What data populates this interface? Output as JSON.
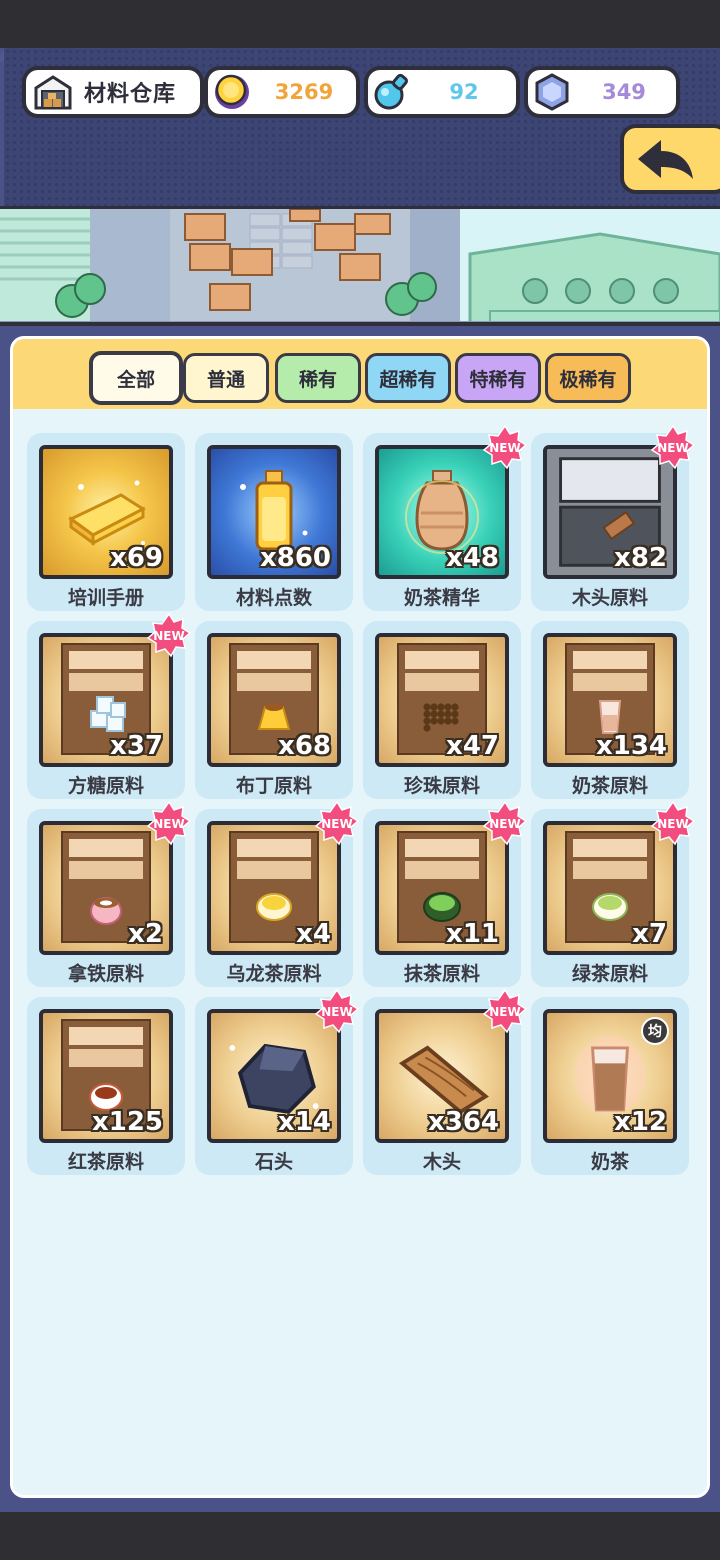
{
  "header": {
    "title": "材料仓库",
    "currencies": [
      {
        "name": "gold-coin",
        "value": "3269",
        "color": "#f0a53a"
      },
      {
        "name": "potion",
        "value": "92",
        "color": "#5fc8ea"
      },
      {
        "name": "gem",
        "value": "349",
        "color": "#a58ad8"
      }
    ]
  },
  "tabs": [
    {
      "label": "全部",
      "color": "#fffbe8",
      "active": true
    },
    {
      "label": "普通",
      "color": "#fff6cf"
    },
    {
      "label": "稀有",
      "color": "#b6ecab"
    },
    {
      "label": "超稀有",
      "color": "#8fd7f5"
    },
    {
      "label": "特稀有",
      "color": "#c9a6f5"
    },
    {
      "label": "极稀有",
      "color": "#f7bc57"
    }
  ],
  "items": [
    {
      "name": "培训手册",
      "count": "x69",
      "icon": "book-icon",
      "bg": "gold",
      "is_new": false
    },
    {
      "name": "材料点数",
      "count": "x860",
      "icon": "bottle-icon",
      "bg": "blue",
      "is_new": false
    },
    {
      "name": "奶茶精华",
      "count": "x48",
      "icon": "jar-icon",
      "bg": "teal",
      "is_new": true
    },
    {
      "name": "木头原料",
      "count": "x82",
      "icon": "wood-crate-icon",
      "bg": "tan",
      "is_new": true
    },
    {
      "name": "方糖原料",
      "count": "x37",
      "icon": "sugar-cube-icon",
      "bg": "tan",
      "is_new": true
    },
    {
      "name": "布丁原料",
      "count": "x68",
      "icon": "pudding-icon",
      "bg": "tan",
      "is_new": false
    },
    {
      "name": "珍珠原料",
      "count": "x47",
      "icon": "pearl-icon",
      "bg": "tan",
      "is_new": false
    },
    {
      "name": "奶茶原料",
      "count": "x134",
      "icon": "cup-icon",
      "bg": "tan",
      "is_new": false
    },
    {
      "name": "拿铁原料",
      "count": "x2",
      "icon": "latte-icon",
      "bg": "tan",
      "is_new": true
    },
    {
      "name": "乌龙茶原料",
      "count": "x4",
      "icon": "oolong-tea-icon",
      "bg": "tan",
      "is_new": true
    },
    {
      "name": "抹茶原料",
      "count": "x11",
      "icon": "matcha-icon",
      "bg": "tan",
      "is_new": true
    },
    {
      "name": "绿茶原料",
      "count": "x7",
      "icon": "green-tea-icon",
      "bg": "tan",
      "is_new": true
    },
    {
      "name": "红茶原料",
      "count": "x125",
      "icon": "black-tea-icon",
      "bg": "tan",
      "is_new": false
    },
    {
      "name": "石头",
      "count": "x14",
      "icon": "stone-icon",
      "bg": "tan",
      "is_new": true
    },
    {
      "name": "木头",
      "count": "x364",
      "icon": "wood-plank-icon",
      "bg": "tan",
      "is_new": true
    },
    {
      "name": "奶茶",
      "count": "x12",
      "icon": "milk-tea-icon",
      "bg": "tan",
      "is_new": false,
      "badge": "均"
    }
  ],
  "new_badge_text": "NEW"
}
